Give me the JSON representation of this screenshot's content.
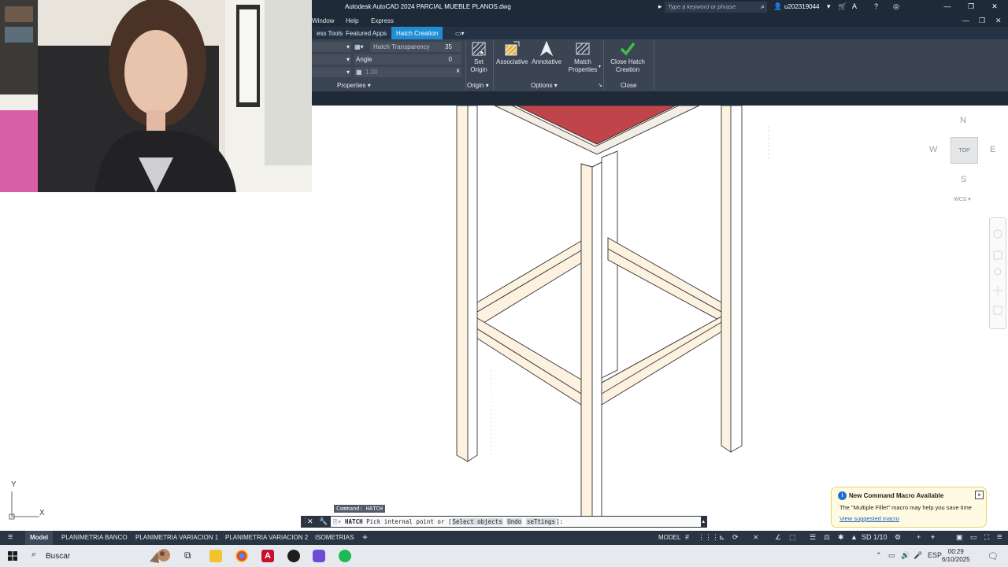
{
  "window": {
    "title": "Autodesk AutoCAD 2024    PARCIAL MUEBLE PLANOS.dwg",
    "search_placeholder": "Type a keyword or phrase",
    "user": "u202319044"
  },
  "menu": {
    "items": [
      "Window",
      "Help",
      "Express"
    ]
  },
  "ribbon_tabs": [
    "ess Tools",
    "Featured Apps",
    "Hatch Creation"
  ],
  "ribbon": {
    "properties": {
      "transparency_label": "Hatch Transparency",
      "transparency_value": "35",
      "angle_label": "Angle",
      "angle_value": "0",
      "scale_value": "1.00",
      "panel_label": "Properties"
    },
    "origin": {
      "set_origin_label": "Set Origin",
      "panel_label": "Origin"
    },
    "options": {
      "associative_label": "Associative",
      "annotative_label": "Annotative",
      "match_label": "Match Properties",
      "panel_label": "Options"
    },
    "close": {
      "close_label": "Close Hatch Creation",
      "panel_label": "Close"
    }
  },
  "viewcube": {
    "north": "N",
    "south": "S",
    "east": "E",
    "west": "W",
    "face": "TOP",
    "wcs": "WCS"
  },
  "ucs": {
    "y": "Y",
    "x": "X"
  },
  "command": {
    "history": "Command: HATCH",
    "prompt_cmd": "HATCH",
    "prompt_text": "Pick internal point or [",
    "opt1": "Select objects",
    "opt2": "Undo",
    "opt3": "seTtings",
    "prompt_end": "]:"
  },
  "notification": {
    "title": "New Command Macro Available",
    "body": "The \"Multiple Fillet\" macro may help you save time",
    "link": "View suggested macro"
  },
  "layout_tabs": [
    "Model",
    "PLANIMETRIA BANCO",
    "PLANIMETRIA VARIACION 1",
    "PLANIMETRIA VARIACION 2",
    "ISOMETRIAS"
  ],
  "status": {
    "model": "MODEL",
    "scale": "SD 1/10"
  },
  "taskbar": {
    "search": "Buscar",
    "lang": "ESP",
    "time": "00:29",
    "date": "6/10/2025"
  },
  "colors": {
    "accent": "#1e8fd6",
    "hatch_fill": "#fdf1df",
    "seat_red": "#c0454a"
  }
}
